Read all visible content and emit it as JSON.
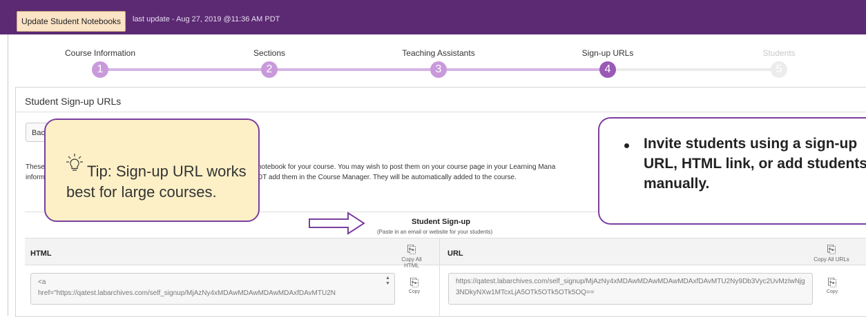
{
  "topbar": {
    "update_button": "Update Student Notebooks",
    "last_update": "last update - Aug 27, 2019 @11:36 AM PDT"
  },
  "steps": [
    {
      "label": "Course Information",
      "number": "1"
    },
    {
      "label": "Sections",
      "number": "2"
    },
    {
      "label": "Teaching Assistants",
      "number": "3"
    },
    {
      "label": "Sign-up URLs",
      "number": "4"
    },
    {
      "label": "Students",
      "number": "5"
    }
  ],
  "panel": {
    "title": "Student Sign-up URLs",
    "back_button": "Bac",
    "desc_line1_left": "These",
    "desc_line1_right": "notebook for your course. You may wish to post them on your course page in your Learning Mana",
    "desc_line2_left": "inform",
    "desc_line2_right": "DT add them in the Course Manager. They will be automatically added to the course."
  },
  "signup": {
    "title": "Student Sign-up",
    "subtitle": "(Paste in an email or website for your students)",
    "html_header": "HTML",
    "url_header": "URL",
    "copy_all_html": "Copy All HTML",
    "copy_all_urls": "Copy All URLs",
    "copy_label": "Copy",
    "html_value": "<a\nhref=\"https://qatest.labarchives.com/self_signup/MjAzNy4xMDAwMDAwMDAwMDAxfDAvMTU2N",
    "url_value": "https://qatest.labarchives.com/self_signup/MjAzNy4xMDAwMDAwMDAwMDAxfDAvMTU2Ny9Db3Vyc2UvMzIwNjg3NDkyNXw1MTcxLjA5OTk5OTk5OTk5OQ=="
  },
  "tip": {
    "text": "Tip:  Sign-up URL works best for large courses."
  },
  "callout": {
    "text": "Invite students using a sign-up URL, HTML link, or add students manually."
  },
  "colors": {
    "topbar": "#5b2a73",
    "step_done": "#c99adb",
    "step_active": "#9b59b6",
    "step_inactive": "#ececec",
    "annotation_border": "#7a3ea0",
    "tip_fill": "#fdf0c7"
  }
}
